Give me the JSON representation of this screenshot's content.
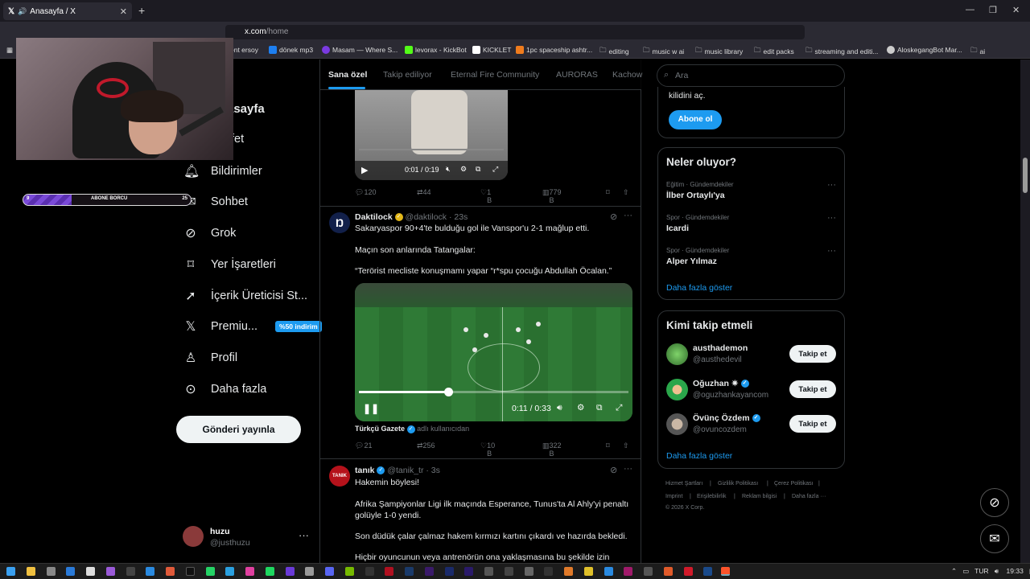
{
  "browser": {
    "tab_title": "Anasayfa / X",
    "tab_close": "✕",
    "new_tab": "+",
    "url_host": "x.com",
    "url_path": "/home",
    "bookmarks": [
      "ent ersoy",
      "dönek mp3",
      "Masam — Where S...",
      "levorax - KickBot",
      "KICKLET",
      "1pc spaceship ashtr...",
      "editing",
      "music w ai",
      "music library",
      "edit packs",
      "streaming and editi...",
      "AloskegangBot Mar...",
      "ai"
    ]
  },
  "overlay": {
    "sub_left": "9",
    "sub_label": "ABONE BORCU",
    "sub_right": "25"
  },
  "nav": {
    "home": "Anasayfa",
    "explore": "Keşfet",
    "notifications": "Bildirimler",
    "chat": "Sohbet",
    "grok": "Grok",
    "bookmarks": "Yer İşaretleri",
    "creator": "İçerik Üreticisi St...",
    "premium": "Premiu...",
    "premium_badge": "%50 indirim",
    "profile": "Profil",
    "more": "Daha fazla",
    "post_button": "Gönderi yayınla",
    "account_name": "huzu",
    "account_handle": "@justhuzu",
    "account_more": "···"
  },
  "timeline": {
    "tabs": [
      "Sana özel",
      "Takip ediliyor",
      "Eternal Fire Community",
      "AURORAS",
      "Kachow"
    ],
    "video1": {
      "time": "0:01 / 0:19",
      "stats": {
        "replies": "120",
        "reposts": "44",
        "likes": "1 B",
        "views": "779 B"
      }
    },
    "tweet2": {
      "name": "Daktilock",
      "handle": "@daktilock",
      "time": "· 23s",
      "line1": "Sakaryaspor 90+4'te bulduğu gol ile Vanspor'u 2-1 mağlup etti.",
      "line2": "Maçın son anlarında Tatangalar:",
      "line3": "“Terörist mecliste konuşmamı yapar “r*spu çocuğu Abdullah Öcalan.”",
      "video_time": "0:11 / 0:33",
      "video_progress": 0.33,
      "source_name": "Türkçü Gazete",
      "source_suffix": "adlı kullanıcıdan",
      "stats": {
        "replies": "21",
        "reposts": "256",
        "likes": "10 B",
        "views": "322 B"
      }
    },
    "tweet3": {
      "name": "tanık",
      "handle": "@tanik_tr",
      "time": "· 3s",
      "avatar_text": "TANIK",
      "line1": "Hakemin böylesi!",
      "line2": "Afrika Şampiyonlar Ligi ilk maçında Esperance, Tunus'ta Al Ahly'yi penaltı golüyle 1-0 yendi.",
      "line3": "Son düdük çalar çalmaz hakem kırmızı kartını çıkardı ve hazırda bekledi.",
      "line4": "Hiçbir oyuncunun veya antrenörün ona yaklaşmasına bu şekilde izin"
    }
  },
  "sidebar": {
    "search_placeholder": "Ara",
    "premium_text": "kilidini aç.",
    "subscribe": "Abone ol",
    "trends_title": "Neler oluyor?",
    "trends": [
      {
        "meta": "Eğitim · Gündemdekiler",
        "name": "İlber Ortaylı'ya"
      },
      {
        "meta": "Spor · Gündemdekiler",
        "name": "Icardi"
      },
      {
        "meta": "Spor · Gündemdekiler",
        "name": "Alper Yılmaz"
      }
    ],
    "trends_more": "Daha fazla göster",
    "who_title": "Kimi takip etmeli",
    "suggestions": [
      {
        "name": "austhademon",
        "handle": "@austhedevil",
        "button": "Takip et"
      },
      {
        "name": "Oğuzhan ✷",
        "handle": "@oguzhankayancom",
        "button": "Takip et"
      },
      {
        "name": "Övünç Özdem",
        "handle": "@ovuncozdem",
        "button": "Takip et"
      }
    ],
    "who_more": "Daha fazla göster",
    "footer": [
      "Hizmet Şartları",
      "|",
      "Gizlilik Politikası",
      "|",
      "Çerez Politikası",
      "|",
      "Imprint",
      "|",
      "Erişilebilirlik",
      "|",
      "Reklam bilgisi",
      "|",
      "Daha fazla ···",
      "© 2026 X Corp."
    ]
  },
  "taskbar": {
    "lang": "TUR",
    "time": "19:33"
  },
  "colors": {
    "accent": "#1d9bf0",
    "background": "#000000",
    "border": "#2f3336",
    "muted": "#71767b"
  }
}
